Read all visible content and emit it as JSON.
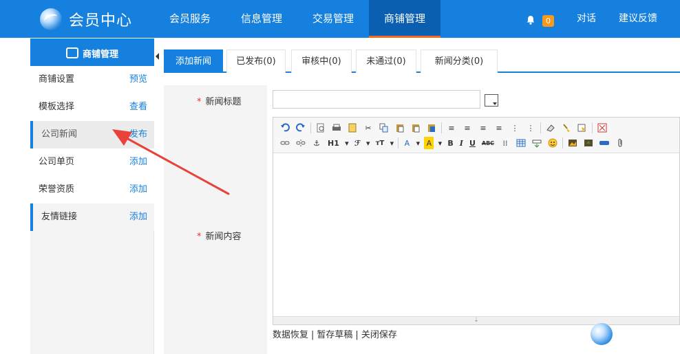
{
  "brand": {
    "title": "会员中心"
  },
  "nav": [
    "会员服务",
    "信息管理",
    "交易管理",
    "商铺管理"
  ],
  "nav_active": 3,
  "header_right": {
    "badge": "0",
    "chat": "对话",
    "feedback": "建议反馈"
  },
  "sidebar": {
    "title": "商铺管理",
    "items": [
      {
        "label": "商铺设置",
        "action": "预览"
      },
      {
        "label": "模板选择",
        "action": "查看"
      },
      {
        "label": "公司新闻",
        "action": "发布"
      },
      {
        "label": "公司单页",
        "action": "添加"
      },
      {
        "label": "荣誉资质",
        "action": "添加"
      },
      {
        "label": "友情链接",
        "action": "添加"
      }
    ]
  },
  "tabs": [
    "添加新闻",
    "已发布(0)",
    "审核中(0)",
    "未通过(0)",
    "新闻分类(0)"
  ],
  "form": {
    "title_label": "新闻标题",
    "title_value": "",
    "content_label": "新闻内容",
    "heading_btn": "H1",
    "font_btn": "ℱ",
    "size_btn": "тT",
    "bold": "B",
    "italic": "I",
    "underline": "U",
    "strike": "ABC"
  },
  "editor_links": [
    "数据恢复",
    "暂存草稿",
    "关闭保存"
  ],
  "colors": {
    "primary": "#1580dd",
    "nav_active_bg": "#0a5fb0",
    "accent": "#f36b22",
    "badge": "#f59a1c",
    "arrow": "#e8423a"
  }
}
